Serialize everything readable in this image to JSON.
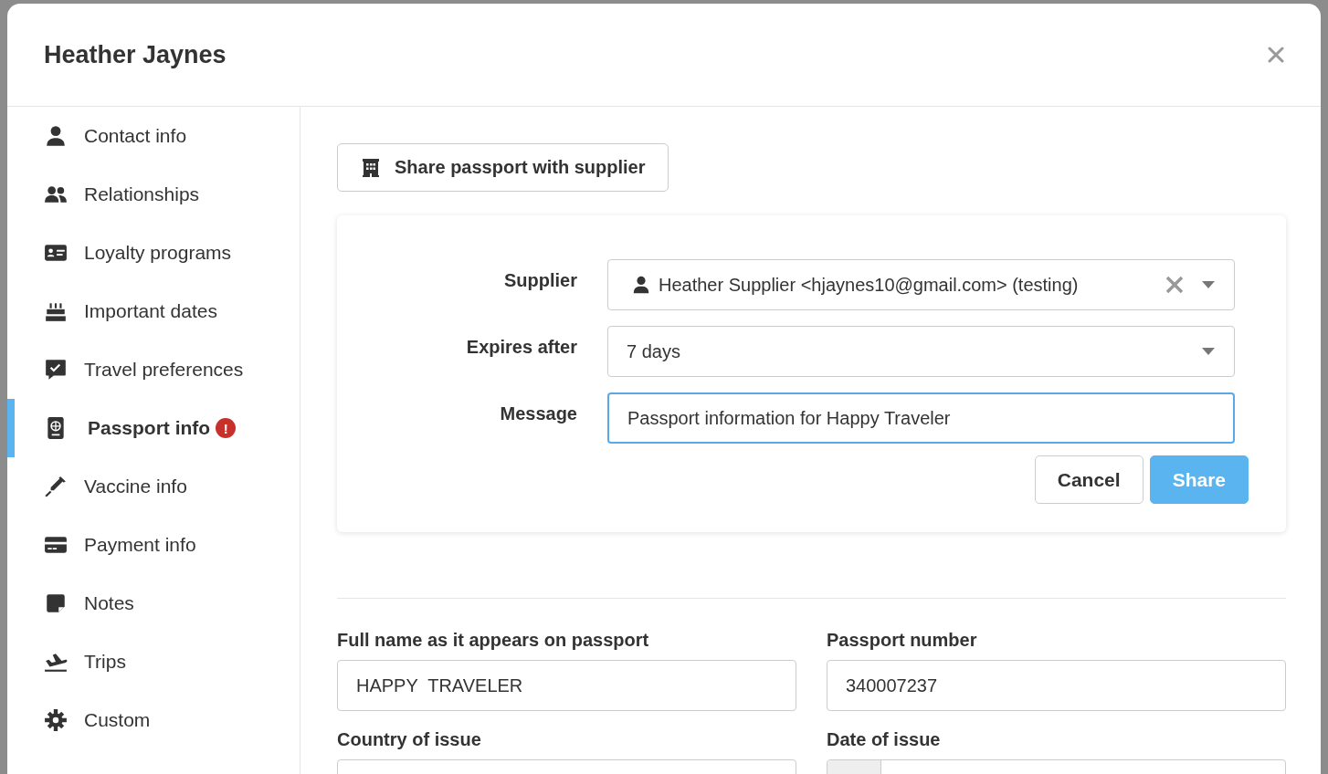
{
  "modal": {
    "title": "Heather Jaynes"
  },
  "sidebar": {
    "items": [
      {
        "label": "Contact info",
        "kind": "person",
        "selected": false
      },
      {
        "label": "Relationships",
        "kind": "people",
        "selected": false
      },
      {
        "label": "Loyalty programs",
        "kind": "card-id",
        "selected": false
      },
      {
        "label": "Important dates",
        "kind": "cake",
        "selected": false
      },
      {
        "label": "Travel preferences",
        "kind": "comment-check",
        "selected": false
      },
      {
        "label": "Passport info",
        "kind": "passport",
        "selected": true,
        "badge": "!"
      },
      {
        "label": "Vaccine info",
        "kind": "syringe",
        "selected": false
      },
      {
        "label": "Payment info",
        "kind": "credit-card",
        "selected": false
      },
      {
        "label": "Notes",
        "kind": "note",
        "selected": false
      },
      {
        "label": "Trips",
        "kind": "plane",
        "selected": false
      },
      {
        "label": "Custom",
        "kind": "gear",
        "selected": false
      }
    ]
  },
  "share_button": {
    "label": "Share passport with supplier"
  },
  "share_form": {
    "fields": [
      {
        "label": "Supplier",
        "kind": "person-select",
        "value": "Heather Supplier <hjaynes10@gmail.com> (testing)",
        "focused": false
      },
      {
        "label": "Expires after",
        "kind": "select",
        "value": "7 days",
        "focused": false
      },
      {
        "label": "Message",
        "kind": "text",
        "value": "Passport information for Happy Traveler",
        "focused": true
      }
    ],
    "buttons": [
      {
        "label": "Cancel",
        "kind": "secondary"
      },
      {
        "label": "Share",
        "kind": "primary"
      }
    ]
  },
  "passport": {
    "fields": [
      {
        "label": "Full name as it appears on passport",
        "kind": "text",
        "value": "HAPPY  TRAVELER"
      },
      {
        "label": "Passport number",
        "kind": "text",
        "value": "340007237"
      },
      {
        "label": "Country of issue",
        "kind": "text"
      },
      {
        "label": "Date of issue",
        "kind": "date"
      }
    ]
  }
}
